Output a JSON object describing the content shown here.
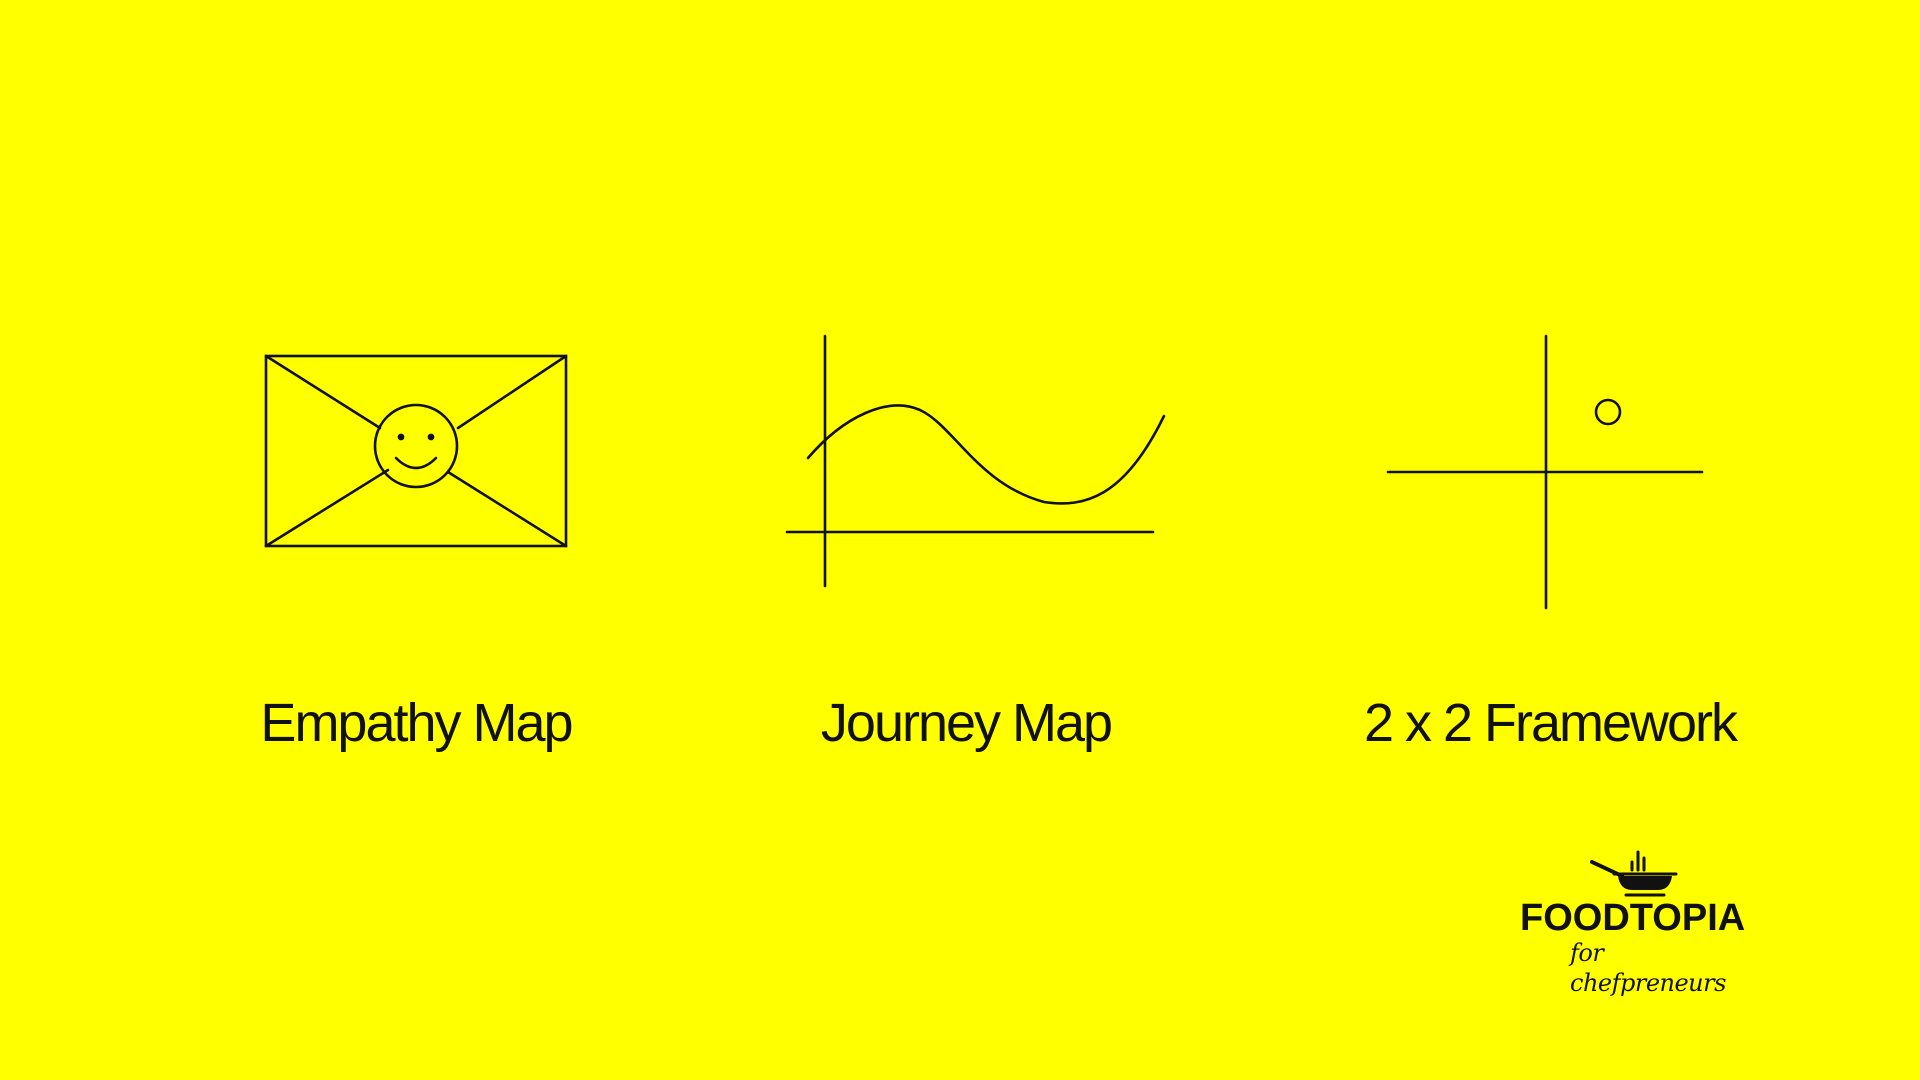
{
  "background_color": "#FFFF00",
  "ink_color": "#111111",
  "cards": [
    {
      "icon": "envelope-smiley-icon",
      "caption": "Empathy Map"
    },
    {
      "icon": "journey-curve-icon",
      "caption": "Journey Map"
    },
    {
      "icon": "quadrant-axes-icon",
      "caption": "2 x 2 Framework"
    }
  ],
  "logo": {
    "icon": "frying-pan-icon",
    "name": "FOODTOPIA",
    "tagline": "for chefpreneurs"
  }
}
